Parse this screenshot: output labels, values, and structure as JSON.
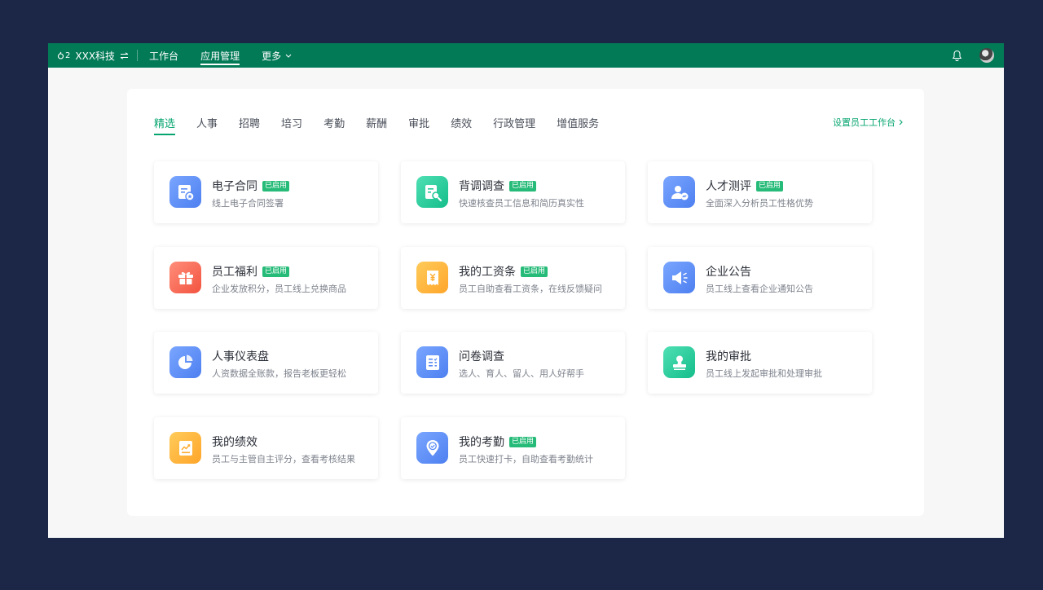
{
  "header": {
    "logo_text": "2",
    "company": "XXX科技",
    "nav": [
      {
        "label": "工作台"
      },
      {
        "label": "应用管理"
      },
      {
        "label": "更多"
      }
    ]
  },
  "tabs": [
    "精选",
    "人事",
    "招聘",
    "培习",
    "考勤",
    "薪酬",
    "审批",
    "绩效",
    "行政管理",
    "增值服务"
  ],
  "settings_link": "设置员工工作台",
  "apps": [
    {
      "title": "电子合同",
      "badge": "已启用",
      "desc": "线上电子合同签署",
      "icon": "contract-icon",
      "color": "#5b8cf6"
    },
    {
      "title": "背调调查",
      "badge": "已启用",
      "desc": "快速核查员工信息和简历真实性",
      "icon": "document-search-icon",
      "color": "#22c796"
    },
    {
      "title": "人才测评",
      "badge": "已启用",
      "desc": "全面深入分析员工性格优势",
      "icon": "user-chart-icon",
      "color": "#5b8cf6"
    },
    {
      "title": "员工福利",
      "badge": "已启用",
      "desc": "企业发放积分，员工线上兑换商品",
      "icon": "gift-icon",
      "color": "#f5604b"
    },
    {
      "title": "我的工资条",
      "badge": "已启用",
      "desc": "员工自助查看工资条，在线反馈疑问",
      "icon": "payslip-icon",
      "color": "#ffad33"
    },
    {
      "title": "企业公告",
      "badge": "",
      "desc": "员工线上查看企业通知公告",
      "icon": "megaphone-icon",
      "color": "#5b8cf6"
    },
    {
      "title": "人事仪表盘",
      "badge": "",
      "desc": "人资数据全账款，报告老板更轻松",
      "icon": "pie-chart-icon",
      "color": "#5b8cf6"
    },
    {
      "title": "问卷调查",
      "badge": "",
      "desc": "选人、育人、留人、用人好帮手",
      "icon": "survey-icon",
      "color": "#5b8cf6"
    },
    {
      "title": "我的审批",
      "badge": "",
      "desc": "员工线上发起审批和处理审批",
      "icon": "stamp-icon",
      "color": "#22c796"
    },
    {
      "title": "我的绩效",
      "badge": "",
      "desc": "员工与主管自主评分，查看考核结果",
      "icon": "performance-icon",
      "color": "#ffad33"
    },
    {
      "title": "我的考勤",
      "badge": "已启用",
      "desc": "员工快速打卡，自助查看考勤统计",
      "icon": "location-check-icon",
      "color": "#5b8cf6"
    }
  ]
}
